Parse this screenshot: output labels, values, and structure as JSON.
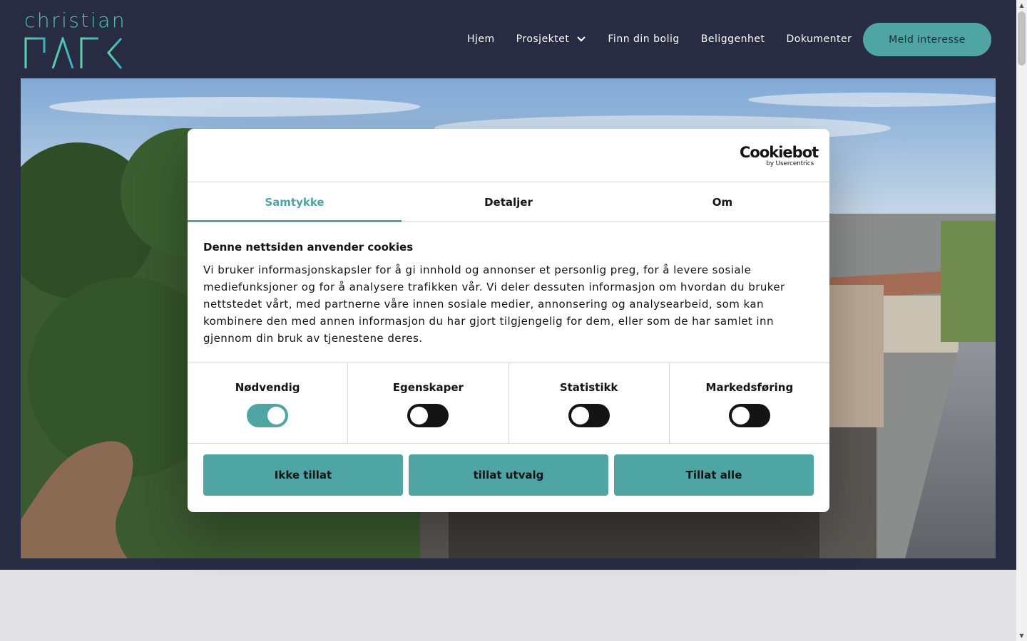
{
  "brand": {
    "logo_top": "christian",
    "logo_bottom": "PARK"
  },
  "nav": {
    "items": [
      {
        "label": "Hjem"
      },
      {
        "label": "Prosjektet",
        "has_dropdown": true
      },
      {
        "label": "Finn din bolig"
      },
      {
        "label": "Beliggenhet"
      },
      {
        "label": "Dokumenter"
      }
    ],
    "cta_label": "Meld interesse"
  },
  "cookie_dialog": {
    "provider_name": "Cookiebot",
    "provider_sub": "by Usercentrics",
    "tabs": [
      {
        "label": "Samtykke",
        "active": true
      },
      {
        "label": "Detaljer",
        "active": false
      },
      {
        "label": "Om",
        "active": false
      }
    ],
    "title": "Denne nettsiden anvender cookies",
    "body": "Vi bruker informasjonskapsler for å gi innhold og annonser et personlig preg, for å levere sosiale mediefunksjoner og for å analysere trafikken vår. Vi deler dessuten informasjon om hvordan du bruker nettstedet vårt, med partnerne våre innen sosiale medier, annonsering og analysearbeid, som kan kombinere den med annen informasjon du har gjort tilgjengelig for dem, eller som de har samlet inn gjennom din bruk av tjenestene deres.",
    "toggles": [
      {
        "label": "Nødvendig",
        "on": true
      },
      {
        "label": "Egenskaper",
        "on": false
      },
      {
        "label": "Statistikk",
        "on": false
      },
      {
        "label": "Markedsføring",
        "on": false
      }
    ],
    "buttons": {
      "deny": "Ikke tillat",
      "allow_selection": "tillat utvalg",
      "allow_all": "Tillat alle"
    }
  },
  "colors": {
    "accent": "#4fa5a4",
    "header_bg": "#282c43",
    "logo": "#4ec3b6"
  }
}
